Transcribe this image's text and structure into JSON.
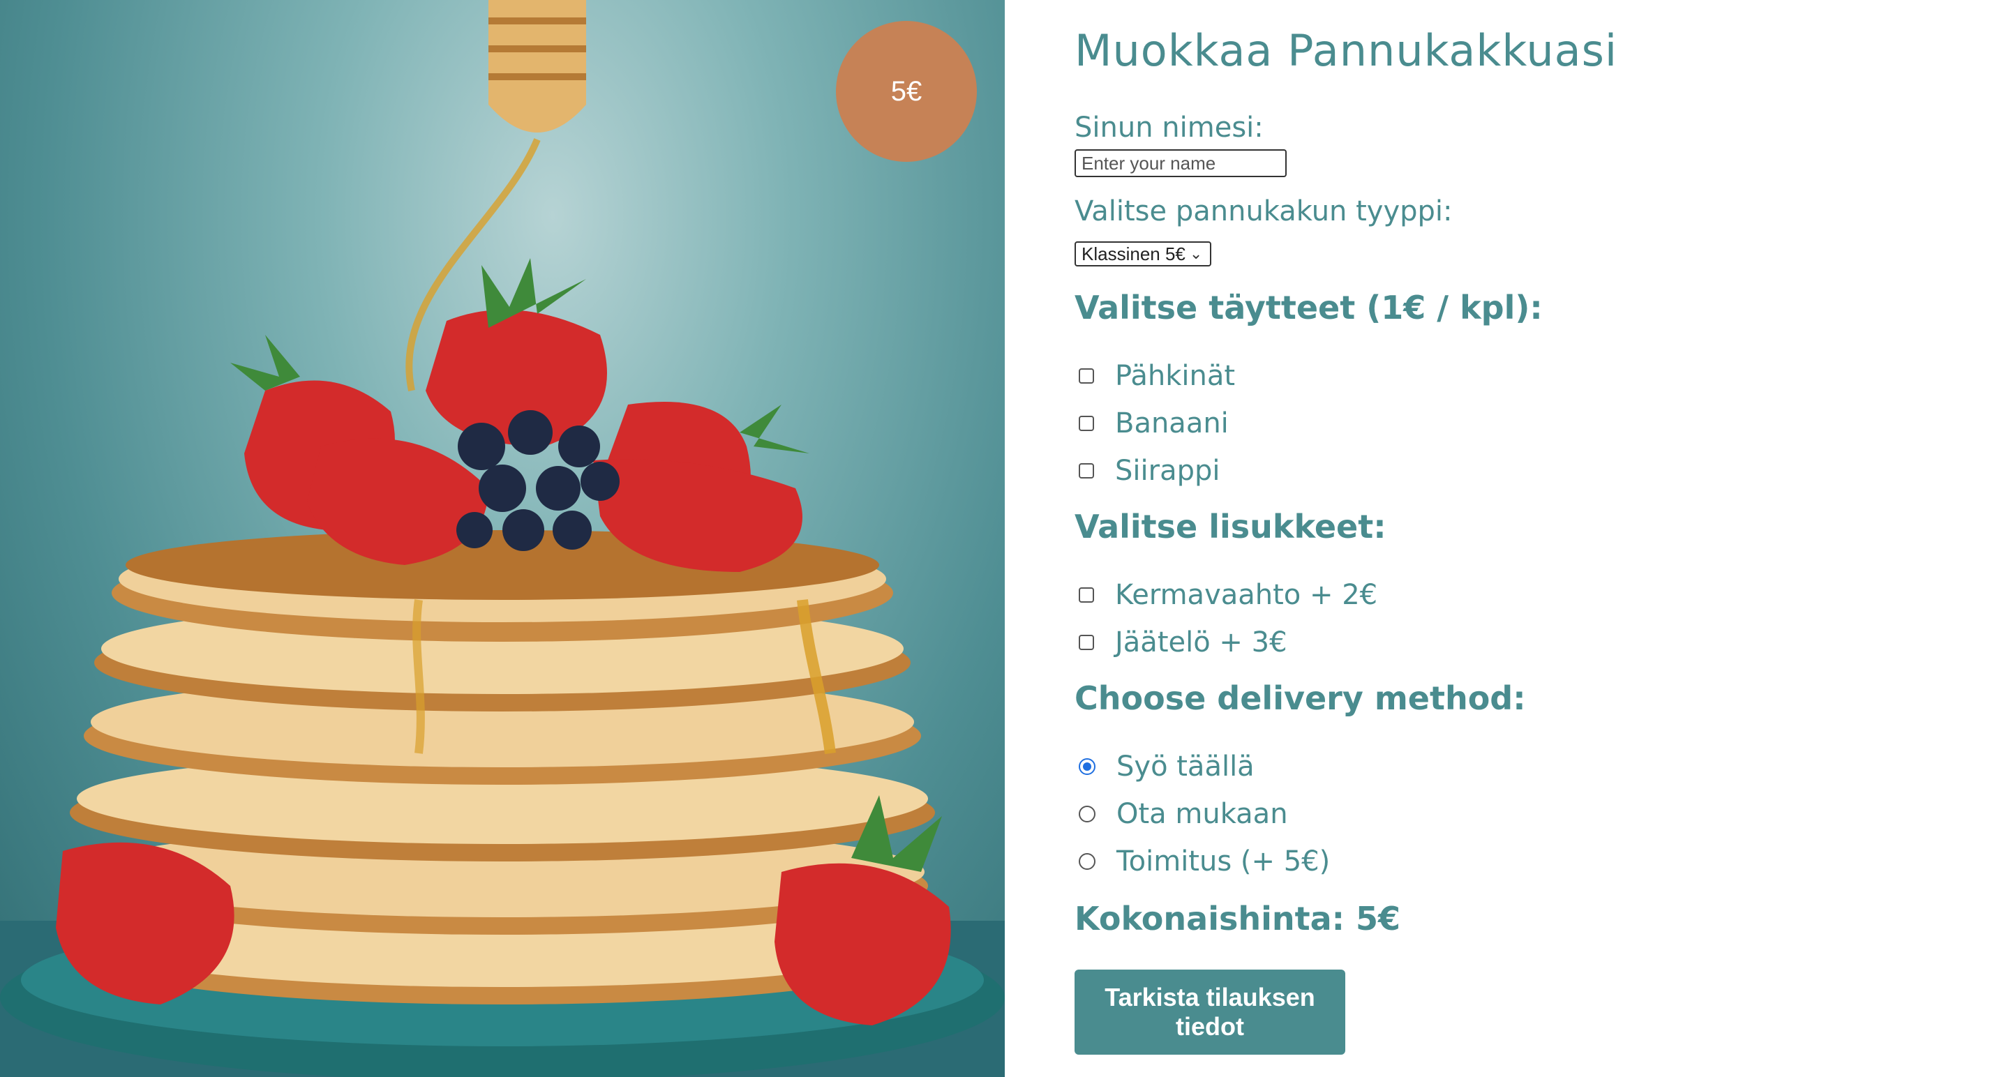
{
  "hero": {
    "price_badge": "5€"
  },
  "form": {
    "title": "Muokkaa Pannukakkuasi",
    "name_label": "Sinun nimesi:",
    "name_placeholder": "Enter your name",
    "type_label": "Valitse pannukakun tyyppi:",
    "type_selected": "Klassinen 5€",
    "toppings_heading": "Valitse täytteet (1€ / kpl):",
    "toppings": [
      {
        "label": "Pähkinät",
        "checked": false
      },
      {
        "label": "Banaani",
        "checked": false
      },
      {
        "label": "Siirappi",
        "checked": false
      }
    ],
    "extras_heading": "Valitse lisukkeet:",
    "extras": [
      {
        "label": "Kermavaahto + 2€",
        "checked": false
      },
      {
        "label": "Jäätelö + 3€",
        "checked": false
      }
    ],
    "delivery_heading": "Choose delivery method:",
    "delivery": [
      {
        "label": "Syö täällä",
        "selected": true
      },
      {
        "label": "Ota mukaan",
        "selected": false
      },
      {
        "label": "Toimitus (+ 5€)",
        "selected": false
      }
    ],
    "total": "Kokonaishinta: 5€",
    "submit_label": "Tarkista tilauksen tiedot"
  },
  "colors": {
    "accent": "#4a8c8f",
    "badge": "#c68256",
    "radio_selected": "#1f6fe0"
  }
}
